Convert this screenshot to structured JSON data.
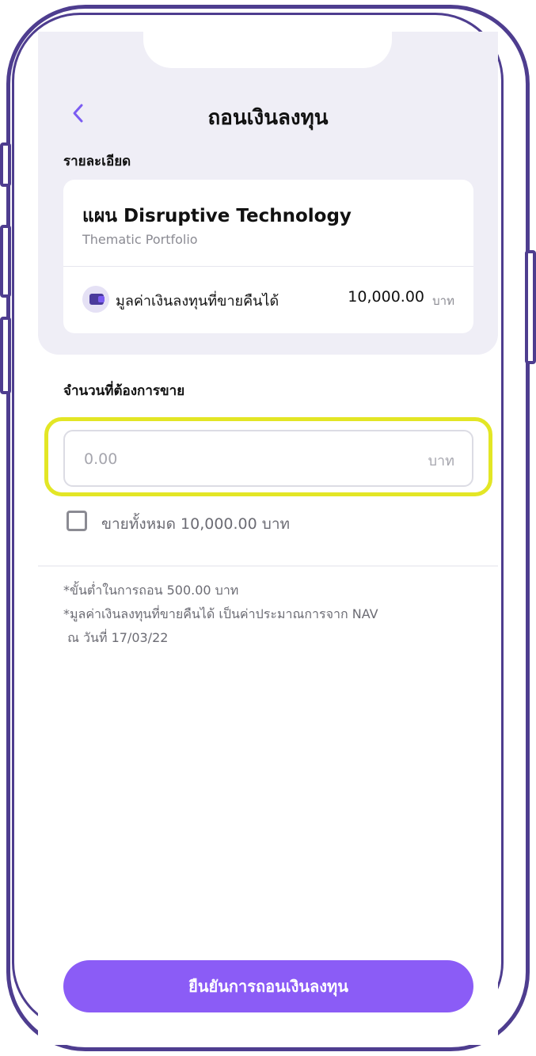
{
  "header": {
    "title": "ถอนเงินลงทุน",
    "back_icon": "chevron-left-icon"
  },
  "details": {
    "section_label": "รายละเอียด",
    "plan_name": "แผน Disruptive Technology",
    "plan_subtitle": "Thematic Portfolio",
    "value_label": "มูลค่าเงินลงทุนที่ขายคืนได้",
    "value_amount": "10,000.00",
    "value_unit": "บาท",
    "value_icon": "wallet-icon"
  },
  "sell": {
    "section_label": "จำนวนที่ต้องการขาย",
    "input_value": "",
    "input_placeholder": "0.00",
    "input_unit": "บาท",
    "sell_all_label": "ขายทั้งหมด 10,000.00 บาท",
    "sell_all_checked": false
  },
  "notes": [
    "*ขั้นต่ำในการถอน 500.00 บาท",
    "*มูลค่าเงินลงทุนที่ขายคืนได้ เป็นค่าประมาณการจาก NAV",
    " ณ วันที่ 17/03/22"
  ],
  "confirm_button": {
    "label": "ยืนยันการถอนเงินลงทุน"
  },
  "colors": {
    "accent": "#8b5cf6",
    "frame": "#4e3d8f",
    "highlight": "#e3e625",
    "top_bg": "#efeef6"
  }
}
